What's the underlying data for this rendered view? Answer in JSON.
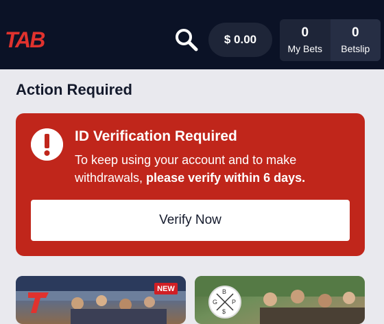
{
  "header": {
    "logo_text": "TAB",
    "balance": "$ 0.00",
    "my_bets": {
      "count": "0",
      "label": "My Bets"
    },
    "betslip": {
      "count": "0",
      "label": "Betslip"
    },
    "colors": {
      "background": "#0b1226",
      "logo": "#e0322e",
      "pill": "#1e2538"
    },
    "icons": [
      "search-icon"
    ]
  },
  "section": {
    "title": "Action Required"
  },
  "alert": {
    "title": "ID Verification Required",
    "body_prefix": "To keep using your account and to make withdrawals, ",
    "body_bold": "please verify within 6 days.",
    "button_label": "Verify Now",
    "icon": "exclamation-icon",
    "color": "#c0261b"
  },
  "promos": [
    {
      "badge": "NEW",
      "logo": "tab-t-logo"
    },
    {
      "logo": "gbp-badge",
      "letters": [
        "B",
        "G",
        "P",
        "$"
      ]
    }
  ]
}
